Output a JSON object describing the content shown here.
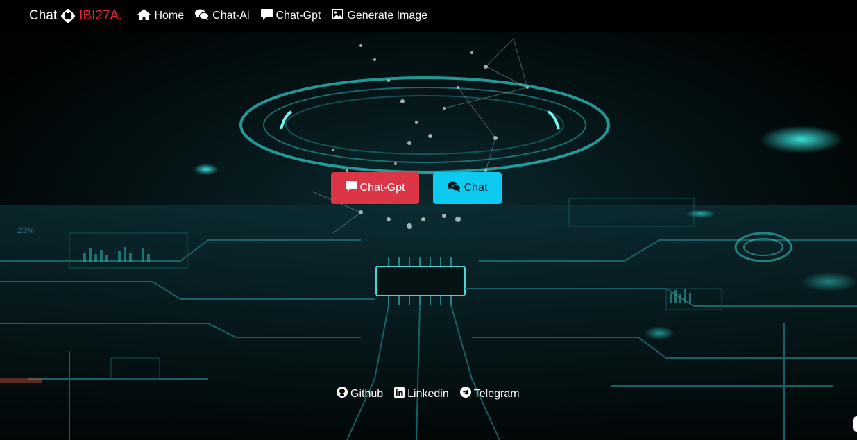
{
  "brand": {
    "text": "Chat",
    "accent_text": "IBI27A.",
    "icon": "crosshair-icon",
    "accent_color": "#e52727"
  },
  "nav": {
    "items": [
      {
        "label": "Home",
        "icon": "home-icon"
      },
      {
        "label": "Chat-Ai",
        "icon": "comments-icon"
      },
      {
        "label": "Chat-Gpt",
        "icon": "comment-icon"
      },
      {
        "label": "Generate Image",
        "icon": "image-icon"
      }
    ]
  },
  "main": {
    "buttons": [
      {
        "label": "Chat-Gpt",
        "icon": "comment-icon",
        "color": "#dc3545"
      },
      {
        "label": "Chat",
        "icon": "comments-icon",
        "color": "#0dcaf0"
      }
    ]
  },
  "footer": {
    "links": [
      {
        "label": "Github",
        "icon": "github-icon"
      },
      {
        "label": "Linkedin",
        "icon": "linkedin-icon"
      },
      {
        "label": "Telegram",
        "icon": "telegram-icon"
      }
    ]
  }
}
